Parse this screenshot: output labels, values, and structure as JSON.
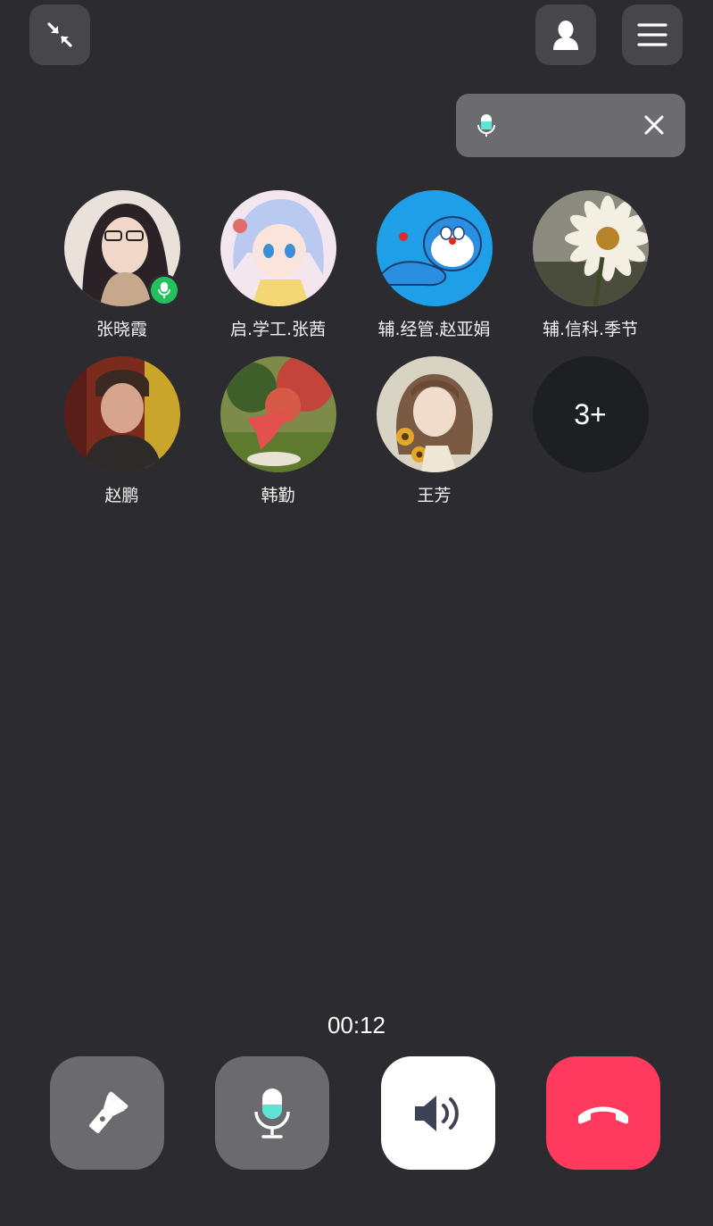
{
  "top_bar": {
    "minimize_icon": "collapse-arrows-icon",
    "contacts_icon": "person-icon",
    "menu_icon": "hamburger-menu-icon"
  },
  "speaking_indicator": {
    "mic_icon": "microphone-icon",
    "close_icon": "close-icon"
  },
  "members": [
    {
      "name": "张晓霞",
      "speaking": true
    },
    {
      "name": "启.学工.张茜",
      "speaking": false
    },
    {
      "name": "辅.经管.赵亚娟",
      "speaking": false
    },
    {
      "name": "辅.信科.季节",
      "speaking": false
    },
    {
      "name": "赵鹏",
      "speaking": false
    },
    {
      "name": "韩勤",
      "speaking": false
    },
    {
      "name": "王芳",
      "speaking": false
    }
  ],
  "more_members": {
    "label": "3+"
  },
  "call": {
    "timer": "00:12"
  },
  "controls": {
    "flashlight_icon": "flashlight-icon",
    "mic_icon": "microphone-icon",
    "speaker_icon": "speaker-icon",
    "hangup_icon": "hang-up-icon"
  },
  "colors": {
    "background": "#2c2c30",
    "speaking_green": "#22c15e",
    "hangup_red": "#ff3a5e",
    "mic_accent": "#5ee3d5"
  }
}
